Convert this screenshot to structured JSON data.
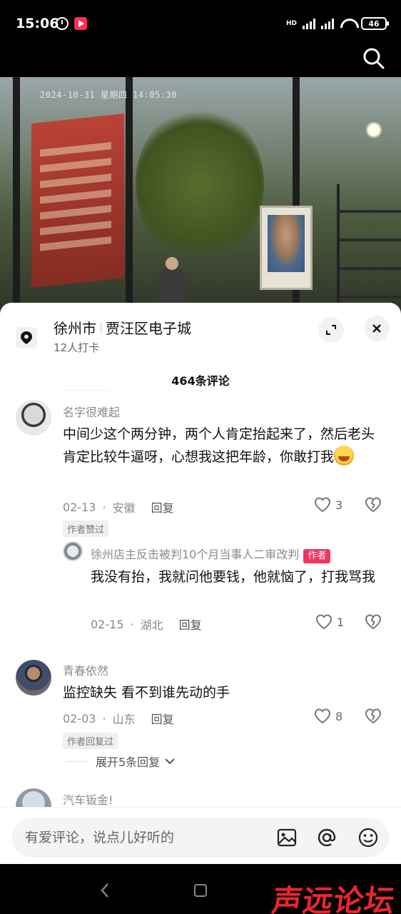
{
  "status_bar": {
    "time": "15:06",
    "battery": "46",
    "network_label": "HD"
  },
  "video": {
    "timestamp_overlay": "2024-10-31  星期四  14:05:30"
  },
  "location": {
    "city": "徐州市",
    "place": "贾汪区电子城",
    "checkins": "12人打卡"
  },
  "comments_header": {
    "count": "464条评论"
  },
  "comments": [
    {
      "username": "名字很难起",
      "text": "中间少这个两分钟，两个人肯定抬起来了，然后老头肯定比较牛逼呀，心想我这把年龄，你敢打我",
      "date": "02-13",
      "region": "安徽",
      "reply_label": "回复",
      "likes": "3",
      "tag": "作者赞过",
      "reply": {
        "username": "徐州店主反击被判10个月当事人二审改判",
        "author_badge": "作者",
        "text": "我没有抬，我就问他要钱，他就恼了，打我骂我",
        "date": "02-15",
        "region": "湖北",
        "reply_label": "回复",
        "likes": "1"
      }
    },
    {
      "username": "青春依然",
      "text": "监控缺失 看不到谁先动的手",
      "date": "02-03",
      "region": "山东",
      "reply_label": "回复",
      "likes": "8",
      "tag": "作者回复过",
      "expand_label": "展开5条回复"
    },
    {
      "username": "汽车钣金!"
    }
  ],
  "input": {
    "placeholder": "有爱评论，说点儿好听的"
  },
  "watermark": "声远论坛",
  "colors": {
    "author_badge": "#f0355f",
    "watermark": "#e8262e"
  }
}
